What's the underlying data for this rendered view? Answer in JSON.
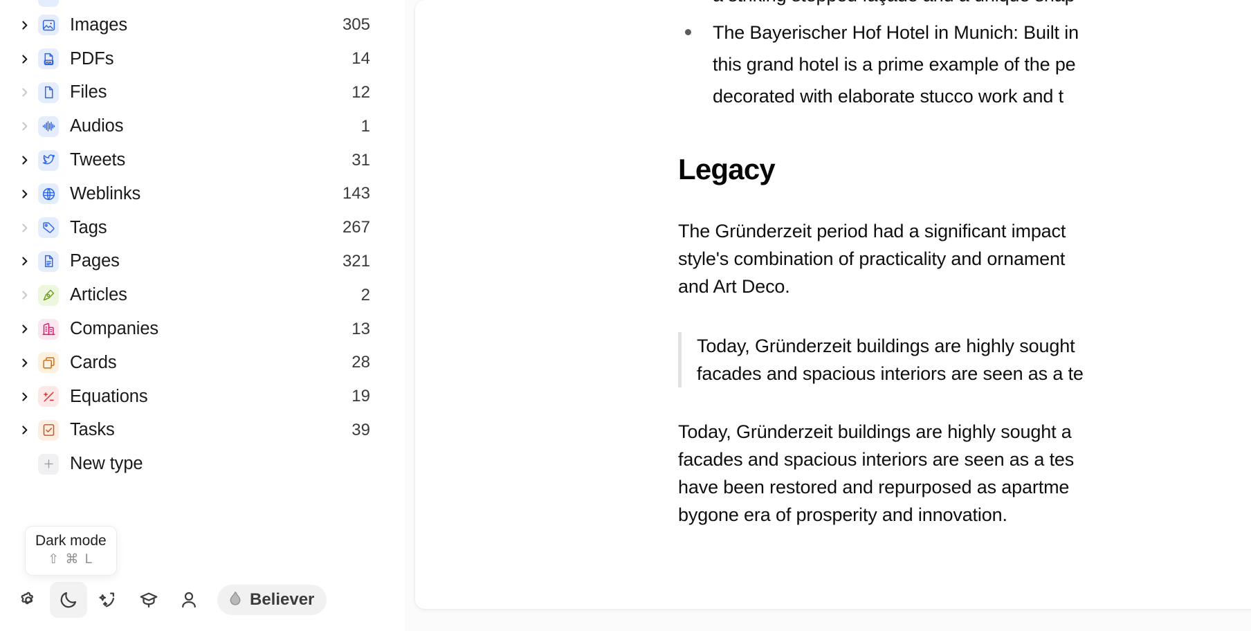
{
  "sidebar": {
    "items": [
      {
        "label": "Images",
        "count": "305",
        "icon": "image-icon",
        "expandable": true,
        "icon_bg": "#e5edfd",
        "icon_color": "#2b64e8"
      },
      {
        "label": "PDFs",
        "count": "14",
        "icon": "pdf-icon",
        "expandable": true,
        "icon_bg": "#e5edfd",
        "icon_color": "#2b64e8"
      },
      {
        "label": "Files",
        "count": "12",
        "icon": "file-icon",
        "expandable": false,
        "icon_bg": "#e5edfd",
        "icon_color": "#2b64e8"
      },
      {
        "label": "Audios",
        "count": "1",
        "icon": "waveform-icon",
        "expandable": false,
        "icon_bg": "#e5edfd",
        "icon_color": "#2b64e8"
      },
      {
        "label": "Tweets",
        "count": "31",
        "icon": "twitter-icon",
        "expandable": true,
        "icon_bg": "#e5edfd",
        "icon_color": "#2b64e8"
      },
      {
        "label": "Weblinks",
        "count": "143",
        "icon": "globe-icon",
        "expandable": true,
        "icon_bg": "#e5edfd",
        "icon_color": "#2b64e8"
      },
      {
        "label": "Tags",
        "count": "267",
        "icon": "tag-icon",
        "expandable": false,
        "icon_bg": "#e5edfd",
        "icon_color": "#2b64e8"
      },
      {
        "label": "Pages",
        "count": "321",
        "icon": "page-icon",
        "expandable": true,
        "icon_bg": "#e5edfd",
        "icon_color": "#2b64e8"
      },
      {
        "label": "Articles",
        "count": "2",
        "icon": "pen-nib-icon",
        "expandable": false,
        "icon_bg": "#edf7dd",
        "icon_color": "#6f9c21"
      },
      {
        "label": "Companies",
        "count": "13",
        "icon": "building-icon",
        "expandable": true,
        "icon_bg": "#fce7f0",
        "icon_color": "#d21e6d"
      },
      {
        "label": "Cards",
        "count": "28",
        "icon": "cards-icon",
        "expandable": true,
        "icon_bg": "#fdf1dd",
        "icon_color": "#c96a12"
      },
      {
        "label": "Equations",
        "count": "19",
        "icon": "plus-minus-icon",
        "expandable": true,
        "icon_bg": "#fde8e8",
        "icon_color": "#dc2b2b"
      },
      {
        "label": "Tasks",
        "count": "39",
        "icon": "checkbox-icon",
        "expandable": true,
        "icon_bg": "#fdeee2",
        "icon_color": "#c9501c"
      }
    ],
    "new_type": {
      "label": "New type",
      "icon": "plus-icon"
    }
  },
  "tooltip": {
    "title": "Dark mode",
    "shortcut": "⇧ ⌘ L"
  },
  "bottom_bar": {
    "buttons": [
      {
        "name": "settings-button",
        "icon": "gear-icon"
      },
      {
        "name": "dark-mode-button",
        "icon": "moon-icon",
        "active": true
      },
      {
        "name": "ai-magic-button",
        "icon": "sparkle-arrow-icon"
      },
      {
        "name": "learn-button",
        "icon": "graduation-cap-icon"
      },
      {
        "name": "account-button",
        "icon": "person-icon"
      }
    ],
    "believer": {
      "label": "Believer",
      "icon": "flame-icon"
    }
  },
  "document": {
    "bullets": [
      {
        "lines": [
          "a striking stepped façade and a unique shap",
          "",
          ""
        ]
      },
      {
        "lines": [
          "The Bayerischer Hof Hotel in Munich: Built in",
          "this grand hotel is a prime example of the pe",
          "decorated with elaborate stucco work and t"
        ]
      }
    ],
    "heading": "Legacy",
    "paragraph_1": [
      "The Gründerzeit period had a significant impact",
      "style's combination of practicality and ornament",
      "and Art Deco."
    ],
    "blockquote": [
      "Today, Gründerzeit buildings are highly sought",
      "facades and spacious interiors are seen as a te"
    ],
    "paragraph_2": [
      "Today, Gründerzeit buildings are highly sought a",
      "facades and spacious interiors are seen as a tes",
      "have been restored and repurposed as apartme",
      "bygone era of prosperity and innovation."
    ]
  }
}
